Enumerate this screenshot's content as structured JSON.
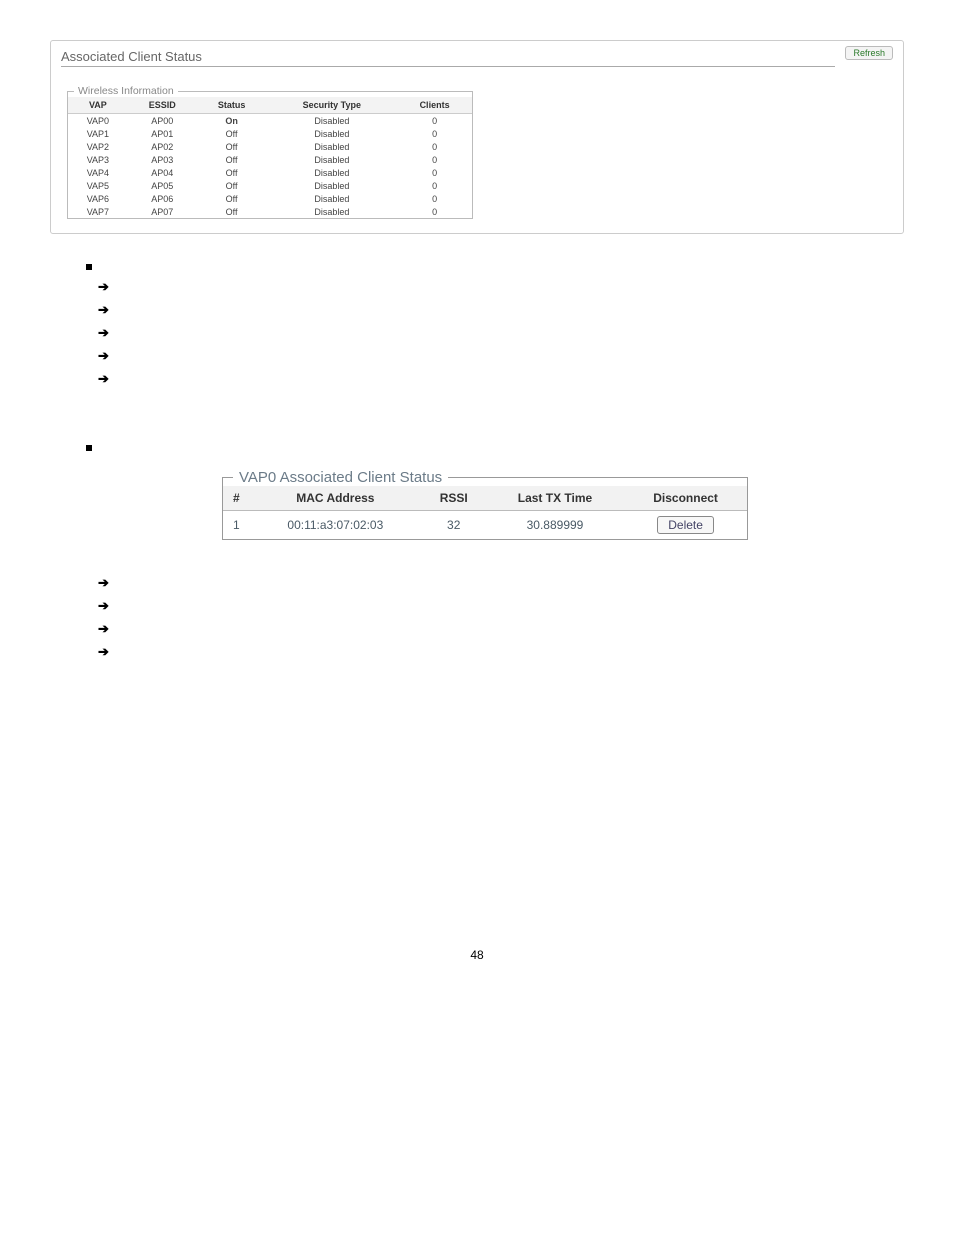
{
  "panel1": {
    "title": "Associated Client Status",
    "refresh_label": "Refresh",
    "fieldset_legend": "Wireless Information",
    "columns": [
      "VAP",
      "ESSID",
      "Status",
      "Security Type",
      "Clients"
    ],
    "rows": [
      {
        "vap": "VAP0",
        "essid": "AP00",
        "status": "On",
        "on": true,
        "sec": "Disabled",
        "clients": "0"
      },
      {
        "vap": "VAP1",
        "essid": "AP01",
        "status": "Off",
        "on": false,
        "sec": "Disabled",
        "clients": "0"
      },
      {
        "vap": "VAP2",
        "essid": "AP02",
        "status": "Off",
        "on": false,
        "sec": "Disabled",
        "clients": "0"
      },
      {
        "vap": "VAP3",
        "essid": "AP03",
        "status": "Off",
        "on": false,
        "sec": "Disabled",
        "clients": "0"
      },
      {
        "vap": "VAP4",
        "essid": "AP04",
        "status": "Off",
        "on": false,
        "sec": "Disabled",
        "clients": "0"
      },
      {
        "vap": "VAP5",
        "essid": "AP05",
        "status": "Off",
        "on": false,
        "sec": "Disabled",
        "clients": "0"
      },
      {
        "vap": "VAP6",
        "essid": "AP06",
        "status": "Off",
        "on": false,
        "sec": "Disabled",
        "clients": "0"
      },
      {
        "vap": "VAP7",
        "essid": "AP07",
        "status": "Off",
        "on": false,
        "sec": "Disabled",
        "clients": "0"
      }
    ]
  },
  "arrows1_count": 5,
  "arrows2_count": 4,
  "arrow_glyph": "➔",
  "panel2": {
    "legend": "VAP0 Associated Client Status",
    "columns": [
      "#",
      "MAC Address",
      "RSSI",
      "Last TX Time",
      "Disconnect"
    ],
    "row": {
      "num": "1",
      "mac": "00:11:a3:07:02:03",
      "rssi": "32",
      "last_tx": "30.889999",
      "delete_label": "Delete"
    }
  },
  "page_number": "48"
}
